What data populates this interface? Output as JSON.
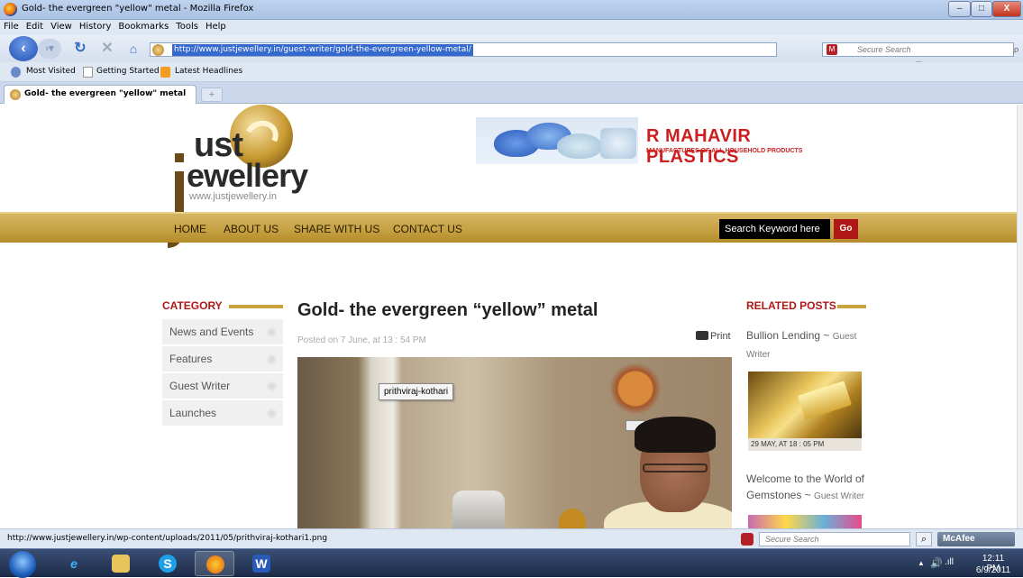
{
  "window": {
    "title": "Gold- the evergreen \"yellow\" metal - Mozilla Firefox",
    "min": "–",
    "max": "□",
    "close": "X"
  },
  "menu": [
    "File",
    "Edit",
    "View",
    "History",
    "Bookmarks",
    "Tools",
    "Help"
  ],
  "nav": {
    "url": "http://www.justjewellery.in/guest-writer/gold-the-evergreen-yellow-metal/",
    "search_placeholder": "Secure Search",
    "back_icon": "back-arrow-icon",
    "reload_icon": "reload-icon",
    "stop_icon": "stop-icon",
    "home_icon": "home-icon"
  },
  "bookmarks": [
    "Most Visited",
    "Getting Started",
    "Latest Headlines"
  ],
  "tab": {
    "title": "Gold- the evergreen \"yellow\" metal",
    "new_tab": "+"
  },
  "site": {
    "logo_part1": "ust",
    "logo_part2": "ewellery",
    "logo_url": "www.justjewellery.in",
    "ad_title": "R MAHAVIR PLASTICS",
    "ad_sub": "MANUFACTURES OF ALL HOUSEHOLD PRODUCTS",
    "nav_items": [
      "HOME",
      "ABOUT US",
      "SHARE WITH US",
      "CONTACT US"
    ],
    "search_placeholder": "Search Keyword here",
    "search_go": "Go"
  },
  "sidebar": {
    "heading": "CATEGORY",
    "items": [
      "News and Events",
      "Features",
      "Guest Writer",
      "Launches"
    ]
  },
  "article": {
    "title": "Gold- the evergreen “yellow” metal",
    "meta": "Posted on 7 June, at 13 : 54 PM",
    "print": "Print",
    "tooltip": "prithviraj-kothari"
  },
  "related": {
    "heading": "RELATED POSTS",
    "post1_title": "Bullion Lending ~ ",
    "post1_cat": "Guest Writer",
    "post1_date": "29 MAY, AT 18 : 05 PM",
    "post2_title": "Welcome to the World of Gemstones ~ ",
    "post2_cat": "Guest Writer"
  },
  "status": {
    "text": "http://www.justjewellery.in/wp-content/uploads/2011/05/prithviraj-kothari1.png",
    "search_placeholder": "Secure Search",
    "mcafee": "McAfee"
  },
  "taskbar": {
    "time": "12:11 PM",
    "date": "6/9/2011"
  }
}
